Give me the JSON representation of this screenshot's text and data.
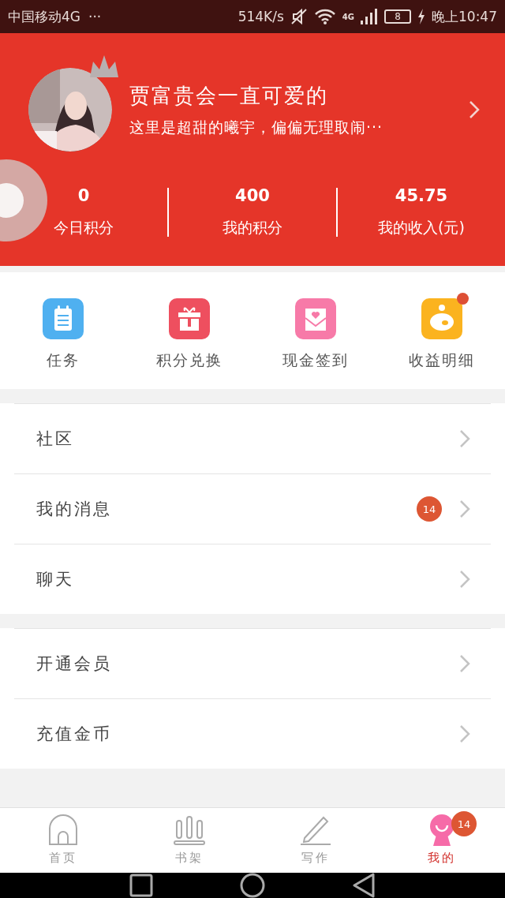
{
  "status_bar": {
    "carrier": "中国移动4G",
    "more": "···",
    "speed": "514K/s",
    "network": "4G",
    "battery": "8",
    "time": "晚上10:47"
  },
  "profile": {
    "name": "贾富贵会一直可爱的",
    "bio": "这里是超甜的曦宇，偏偏无理取闹···",
    "stats": [
      {
        "value": "0",
        "label": "今日积分"
      },
      {
        "value": "400",
        "label": "我的积分"
      },
      {
        "value": "45.75",
        "label": "我的收入(元)"
      }
    ]
  },
  "shortcuts": [
    {
      "kind": "task",
      "label": "任务",
      "dot": false
    },
    {
      "kind": "gift",
      "label": "积分兑换",
      "dot": false
    },
    {
      "kind": "envelope",
      "label": "现金签到",
      "dot": false
    },
    {
      "kind": "piggy",
      "label": "收益明细",
      "dot": true
    }
  ],
  "menu_groups": [
    [
      {
        "label": "社区"
      },
      {
        "label": "我的消息",
        "badge": "14"
      },
      {
        "label": "聊天"
      }
    ],
    [
      {
        "label": "开通会员"
      },
      {
        "label": "充值金币"
      }
    ]
  ],
  "tabs": [
    {
      "kind": "home",
      "label": "首页",
      "selected": false
    },
    {
      "kind": "shelf",
      "label": "书架",
      "selected": false
    },
    {
      "kind": "write",
      "label": "写作",
      "selected": false
    },
    {
      "kind": "me",
      "label": "我的",
      "selected": true,
      "badge": "14"
    }
  ]
}
